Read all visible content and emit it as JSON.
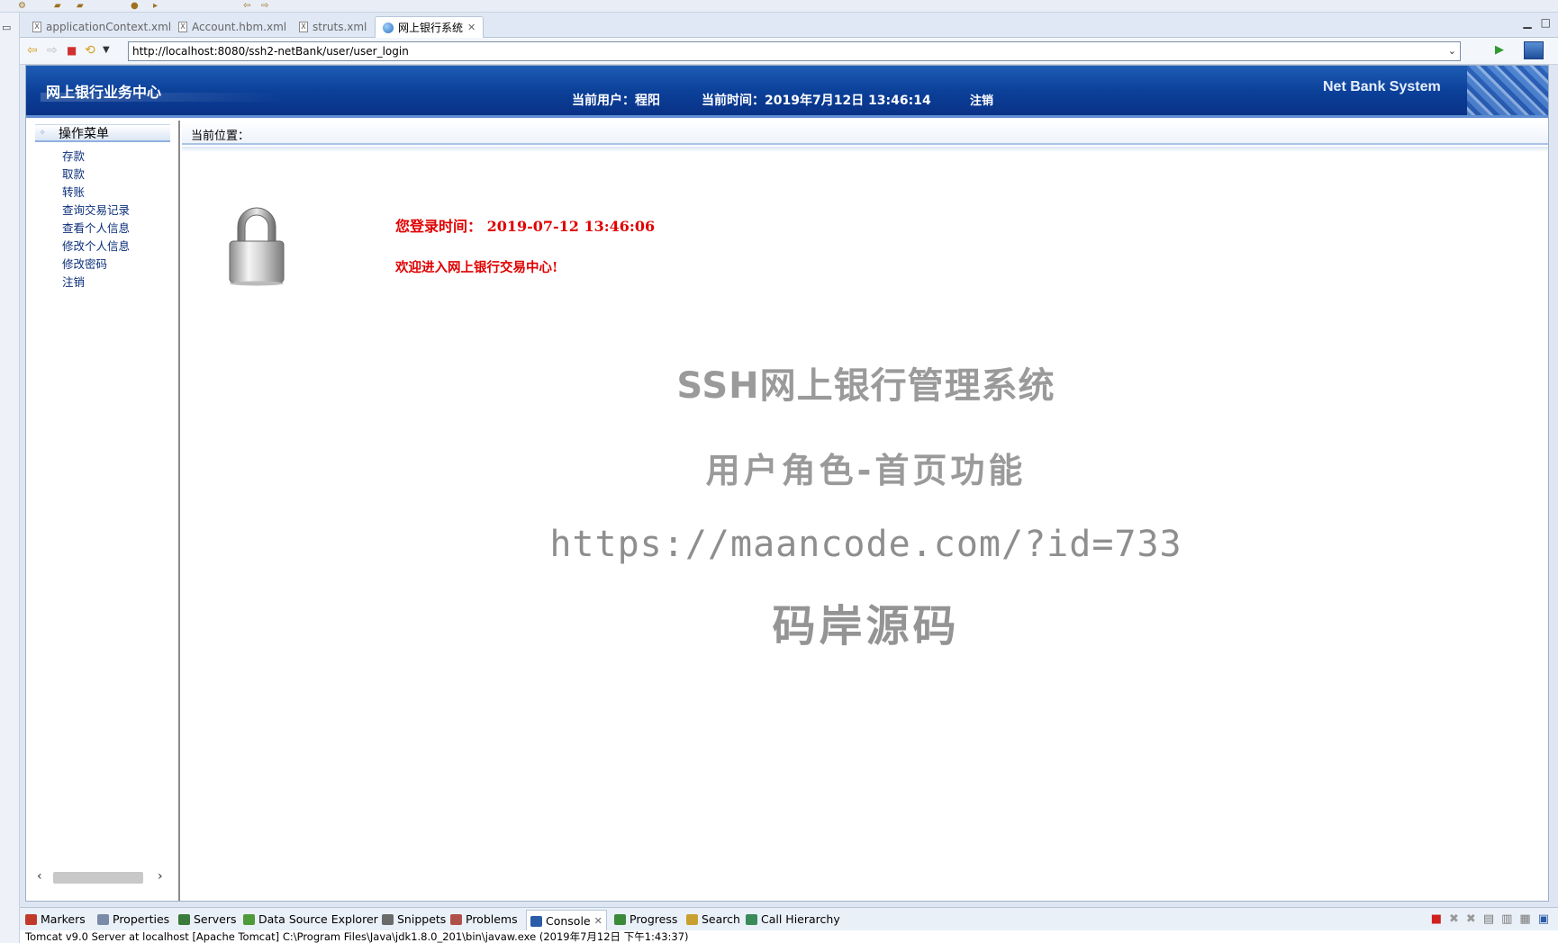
{
  "editor_tabs": [
    {
      "label": "applicationContext.xml",
      "active": false
    },
    {
      "label": "Account.hbm.xml",
      "active": false
    },
    {
      "label": "struts.xml",
      "active": false
    },
    {
      "label": "网上银行系统",
      "active": true
    }
  ],
  "browser": {
    "url": "http://localhost:8080/ssh2-netBank/user/user_login"
  },
  "header": {
    "title": "网上银行业务中心",
    "current_user": "当前用户：程阳",
    "current_time": "当前时间：2019年7月12日 13:46:14",
    "logout": "注销",
    "brand": "Net Bank System"
  },
  "menu": {
    "title": "操作菜单",
    "items": [
      "存款",
      "取款",
      "转账",
      "查询交易记录",
      "查看个人信息",
      "修改个人信息",
      "修改密码",
      "注销"
    ]
  },
  "main": {
    "location": "当前位置：",
    "login_time": "您登录时间： 2019-07-12 13:46:06",
    "welcome": "欢迎进入网上银行交易中心!"
  },
  "watermark": {
    "line1": "SSH网上银行管理系统",
    "line2": "用户角色-首页功能",
    "line3": "https://maancode.com/?id=733",
    "line4": "码岸源码"
  },
  "views_tabs": [
    {
      "label": "Markers",
      "icon_color": "#c0392b"
    },
    {
      "label": "Properties",
      "icon_color": "#7a8aa8"
    },
    {
      "label": "Servers",
      "icon_color": "#3a7a3a"
    },
    {
      "label": "Data Source Explorer",
      "icon_color": "#4f9a3a"
    },
    {
      "label": "Snippets",
      "icon_color": "#6a6a6a"
    },
    {
      "label": "Problems",
      "icon_color": "#b0504a"
    },
    {
      "label": "Console",
      "icon_color": "#2a5ca8",
      "active": true
    },
    {
      "label": "Progress",
      "icon_color": "#3a8a3a"
    },
    {
      "label": "Search",
      "icon_color": "#c8a030"
    },
    {
      "label": "Call Hierarchy",
      "icon_color": "#3a8a5a"
    }
  ],
  "status_line": "Tomcat v9.0 Server at localhost [Apache Tomcat] C:\\Program Files\\Java\\jdk1.8.0_201\\bin\\javaw.exe (2019年7月12日 下午1:43:37)"
}
